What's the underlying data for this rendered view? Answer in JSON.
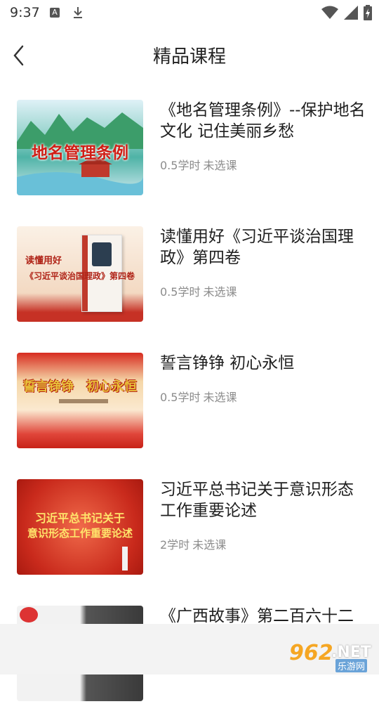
{
  "status_bar": {
    "time": "9:37",
    "a_badge": "A",
    "icons": [
      "a-icon",
      "download-icon",
      "wifi-icon",
      "signal-icon",
      "battery-icon"
    ]
  },
  "header": {
    "title": "精品课程"
  },
  "courses": [
    {
      "title": "《地名管理条例》--保护地名文化 记住美丽乡愁",
      "hours": "0.5学时",
      "status": "未选课",
      "thumb_text": "地名管理条例"
    },
    {
      "title": "读懂用好《习近平谈治国理政》第四卷",
      "hours": "0.5学时",
      "status": "未选课",
      "thumb_text": "读懂用好",
      "thumb_text2": "《习近平谈治国理政》第四卷"
    },
    {
      "title": "誓言铮铮 初心永恒",
      "hours": "0.5学时",
      "status": "未选课",
      "thumb_text": "誓言铮铮　初心永恒"
    },
    {
      "title": "习近平总书记关于意识形态工作重要论述",
      "hours": "2学时",
      "status": "未选课",
      "thumb_text": "习近平总书记关于",
      "thumb_text2": "意识形态工作重要论述"
    },
    {
      "title": "《广西故事》第二百六十二"
    }
  ],
  "watermark": {
    "num": "962",
    "net": ".NET",
    "sub": "乐游网"
  },
  "colors": {
    "accent_red": "#d42a1e",
    "meta_gray": "#8c8c8c"
  }
}
